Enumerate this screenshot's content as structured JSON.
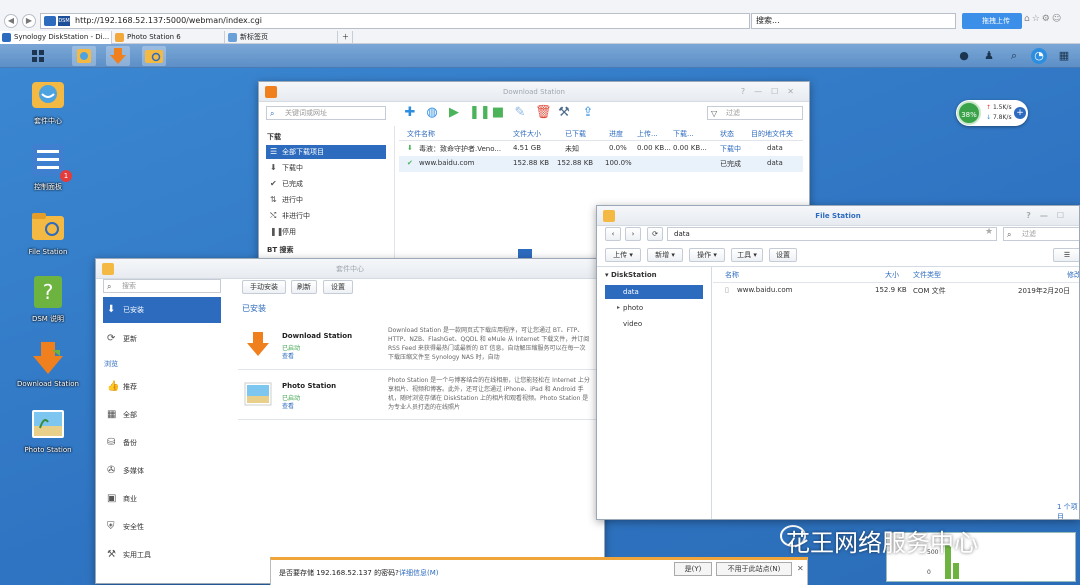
{
  "browser": {
    "url": "http://192.168.52.137:5000/webman/index.cgi",
    "search_placeholder": "搜索...",
    "cloud_button": "拖拽上传",
    "tabs": [
      {
        "label": "Synology DiskStation - Di..."
      },
      {
        "label": "Photo Station 6"
      },
      {
        "label": "新标签页"
      }
    ]
  },
  "desktop": {
    "icons": [
      {
        "label": "套件中心"
      },
      {
        "label": "控制面板",
        "badge": "1"
      },
      {
        "label": "File Station"
      },
      {
        "label": "DSM 说明"
      },
      {
        "label": "Download Station"
      },
      {
        "label": "Photo Station"
      }
    ],
    "resource": {
      "cpu": "38%",
      "upload": "1.5K/s",
      "download": "7.8K/s"
    },
    "watermark": "花王网络服务中心",
    "mini_chart": {
      "labels": [
        "500",
        "0"
      ]
    }
  },
  "download_station": {
    "title": "Download Station",
    "search_placeholder": "关键词或网址",
    "filter_placeholder": "过滤",
    "sections": {
      "download": "下载",
      "bt": "BT 搜索"
    },
    "nav": [
      {
        "label": "全部下载项目"
      },
      {
        "label": "下载中"
      },
      {
        "label": "已完成"
      },
      {
        "label": "进行中"
      },
      {
        "label": "非进行中"
      },
      {
        "label": "停用"
      }
    ],
    "columns": [
      "文件名称",
      "文件大小",
      "已下载",
      "进度",
      "上传...",
      "下载...",
      "状态",
      "目的地文件夹"
    ],
    "rows": [
      {
        "name": "毒液：致命守护者.Veno...",
        "size": "4.51 GB",
        "downloaded": "未知",
        "progress": "0.0%",
        "up": "0.00 KB...",
        "down": "0.00 KB...",
        "status": "下载中",
        "dest": "data"
      },
      {
        "name": "www.baidu.com",
        "size": "152.88 KB",
        "downloaded": "152.88 KB",
        "progress": "100.0%",
        "up": "",
        "down": "",
        "status": "已完成",
        "dest": "data"
      }
    ]
  },
  "file_station": {
    "title": "File Station",
    "path": "data",
    "filter_placeholder": "过滤",
    "toolbar": {
      "upload": "上传",
      "new": "新增",
      "action": "操作",
      "tools": "工具",
      "settings": "设置"
    },
    "tree_root": "DiskStation",
    "folders": [
      "data",
      "photo",
      "video"
    ],
    "columns": {
      "name": "名称",
      "size": "大小",
      "type": "文件类型",
      "modified": "修改"
    },
    "files": [
      {
        "name": "www.baidu.com",
        "size": "152.9 KB",
        "type": "COM 文件",
        "modified": "2019年2月20日"
      }
    ],
    "footer": "1 个项目"
  },
  "package_center": {
    "title": "套件中心",
    "search_placeholder": "搜索",
    "nav_top": [
      {
        "label": "已安装"
      },
      {
        "label": "更新"
      }
    ],
    "browse_head": "浏览",
    "nav_browse": [
      {
        "label": "推荐"
      },
      {
        "label": "全部"
      },
      {
        "label": "备份"
      },
      {
        "label": "多媒体"
      },
      {
        "label": "商业"
      },
      {
        "label": "安全性"
      },
      {
        "label": "实用工具"
      }
    ],
    "buttons": {
      "manual": "手动安装",
      "refresh": "刷新",
      "settings": "设置"
    },
    "section_title": "已安装",
    "packages": [
      {
        "name": "Download Station",
        "status": "已启动",
        "link": "查看",
        "desc": "Download Station 是一款网页式下载应用程序，可让您通过 BT、FTP、HTTP、NZB、FlashGet、QQDL 和 eMule 从 Internet 下载文件，并订阅 RSS Feed 来获得最热门或最新的 BT 信息。自动解压缩服务可以在每一次下载压缩文件至 Synology NAS 时，自动"
      },
      {
        "name": "Photo Station",
        "status": "已启动",
        "link": "查看",
        "desc": "Photo Station 是一个与博客结合的在线相册，让您能轻松在 Internet 上分享相片、视频和博客。此外，还可让您通过 iPhone、iPad 和 Android 手机，随时浏览存储在 DiskStation 上的相片和观看视频。Photo Station 是为专业人员打造的在线照片"
      }
    ]
  },
  "password_bar": {
    "message": "是否要存储 192.168.52.137 的密码?",
    "detail": "详细信息(M)",
    "yes": "是(Y)",
    "never": "不用于此站点(N)"
  },
  "colors": {
    "accent": "#2d6bbf",
    "success": "#3aa34a",
    "warning": "#f0a53a"
  }
}
